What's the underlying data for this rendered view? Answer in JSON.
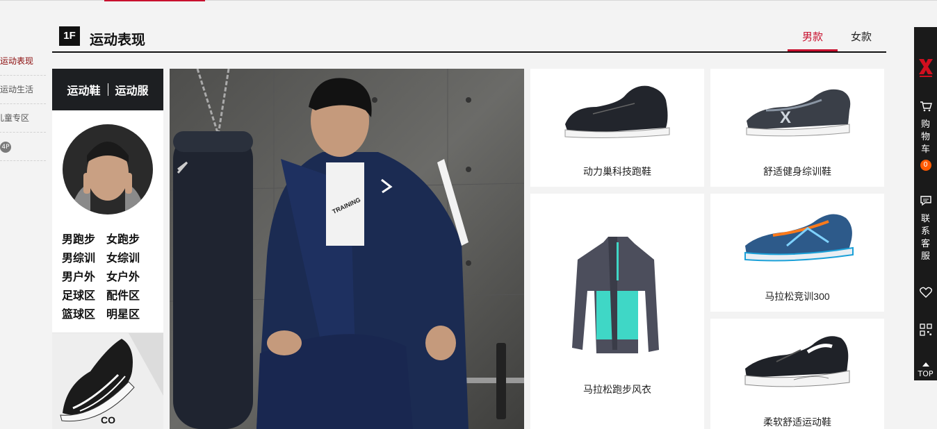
{
  "floor_nav": {
    "items": [
      "运动表现",
      "运动生活",
      "儿童专区"
    ],
    "badge": "4P"
  },
  "floor": {
    "badge": "1F",
    "title": "运动表现",
    "tabs": [
      "男款",
      "女款"
    ]
  },
  "category": {
    "head_left": "运动鞋",
    "head_right": "运动服",
    "links": [
      [
        "男跑步",
        "女跑步"
      ],
      [
        "男综训",
        "女综训"
      ],
      [
        "男户外",
        "女户外"
      ],
      [
        "足球区",
        "配件区"
      ],
      [
        "篮球区",
        "明星区"
      ]
    ],
    "shoe_caption": "CO"
  },
  "products": [
    {
      "name": "动力巢科技跑鞋"
    },
    {
      "name": "舒适健身综训鞋"
    },
    {
      "name": "马拉松跑步风衣"
    },
    {
      "name": "马拉松竞训300"
    },
    {
      "name": "柔软舒适运动鞋"
    }
  ],
  "sidebar": {
    "cart_label": "购物车",
    "cart_count": "0",
    "service_label": "联系客服",
    "top_label": "TOP"
  },
  "colors": {
    "accent": "#c8102e",
    "sidebar": "#1a1a1a",
    "badge_orange": "#ff5a00"
  }
}
